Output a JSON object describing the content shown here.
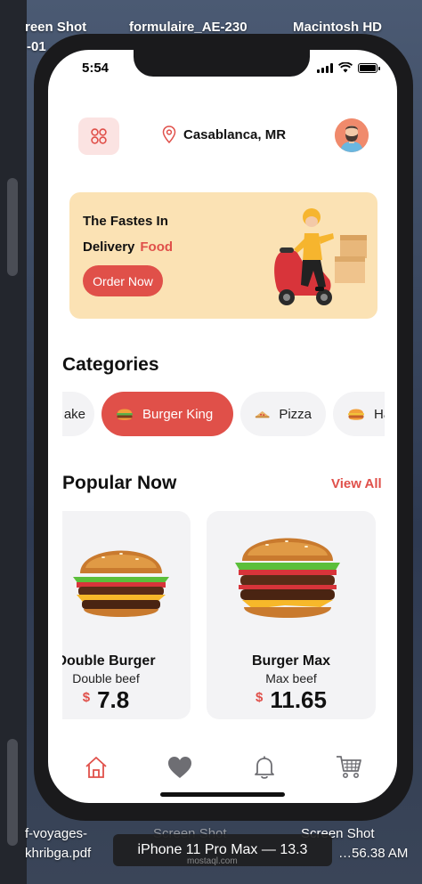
{
  "desktop": {
    "top_labels": [
      "reen Shot",
      "formulaire_AE-230",
      "Macintosh HD"
    ],
    "top_sublabel": "-01",
    "bottom_labels": [
      "f-voyages-",
      "khribga.pdf",
      "Screen Shot",
      "…56.38 AM",
      "Screen Shot",
      "…56.38 AM"
    ]
  },
  "simulator": {
    "caption": "iPhone 11 Pro Max — 13.3",
    "watermark": "mostaql.com"
  },
  "status_bar": {
    "time": "5:54"
  },
  "header": {
    "menu_icon": "grid-icon",
    "location_icon": "pin-icon",
    "location": "Casablanca, MR",
    "avatar": "user-avatar"
  },
  "promo": {
    "line1": "The Fastes In",
    "line2": "Delivery",
    "line2_accent": "Food",
    "button": "Order Now"
  },
  "categories": {
    "title": "Categories",
    "items": [
      {
        "label": "ake",
        "icon": ""
      },
      {
        "label": "Burger King",
        "icon": "burger-icon",
        "active": true
      },
      {
        "label": "Pizza",
        "icon": "pizza-icon"
      },
      {
        "label": "Ha",
        "icon": "burger-icon"
      }
    ]
  },
  "popular": {
    "title": "Popular Now",
    "view_all": "View All",
    "items": [
      {
        "name": "Double Burger",
        "desc": "Double beef",
        "currency": "$",
        "price": "7.8"
      },
      {
        "name": "Burger Max",
        "desc": "Max beef",
        "currency": "$",
        "price": "11.65"
      }
    ]
  },
  "bottom_nav": [
    "home-icon",
    "heart-icon",
    "bell-icon",
    "cart-icon"
  ],
  "colors": {
    "accent": "#e05049",
    "promo_bg": "#fbe2b4",
    "card_bg": "#f3f3f5"
  }
}
